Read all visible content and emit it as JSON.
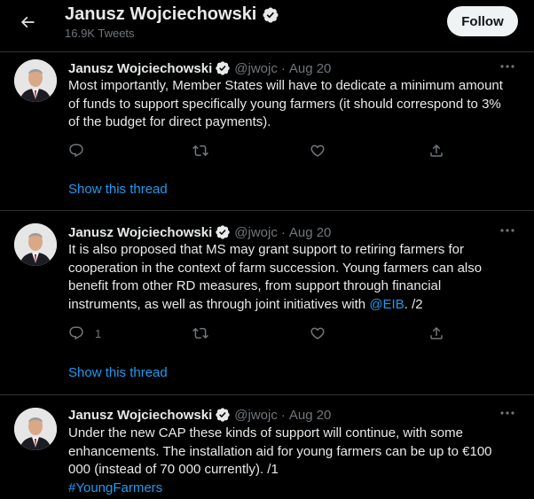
{
  "header": {
    "name": "Janusz Wojciechowski",
    "tweet_count": "16.9K Tweets",
    "follow_label": "Follow"
  },
  "colors": {
    "accent": "#1d9bf0",
    "text": "#e7e9ea",
    "muted": "#71767b",
    "border": "#2f3336",
    "background": "#000000"
  },
  "tweets": [
    {
      "name": "Janusz Wojciechowski",
      "handle": "@jwojc",
      "sep": "·",
      "date": "Aug 20",
      "lines": [
        "Most importantly, Member States will have to dedicate a minimum amount",
        "of funds to support specifically young farmers (it should correspond to 3%",
        "of the budget for direct payments)."
      ],
      "reply_count": "",
      "show_thread": "Show this thread"
    },
    {
      "name": "Janusz Wojciechowski",
      "handle": "@jwojc",
      "sep": "·",
      "date": "Aug 20",
      "lines": [
        "It is also proposed that MS may grant support to retiring farmers for",
        "cooperation in the context of farm succession. Young farmers can also",
        "benefit from other RD measures, from support through financial"
      ],
      "last_line_before": "instruments, as well as through joint initiatives with ",
      "last_line_link": "@EIB",
      "last_line_after": ". /2",
      "reply_count": "1",
      "show_thread": "Show this thread"
    },
    {
      "name": "Janusz Wojciechowski",
      "handle": "@jwojc",
      "sep": "·",
      "date": "Aug 20",
      "lines": [
        "Under the new CAP these kinds of support will continue, with some",
        "enhancements. The installation aid for young farmers can be up to €100",
        "000 (instead of 70 000 currently). /1"
      ],
      "hashtag": "#YoungFarmers"
    }
  ],
  "icons": {
    "back": "arrow-left-icon",
    "verified": "verified-badge-icon",
    "more": "more-horizontal-icon",
    "reply": "reply-icon",
    "retweet": "retweet-icon",
    "like": "heart-icon",
    "share": "share-icon"
  }
}
